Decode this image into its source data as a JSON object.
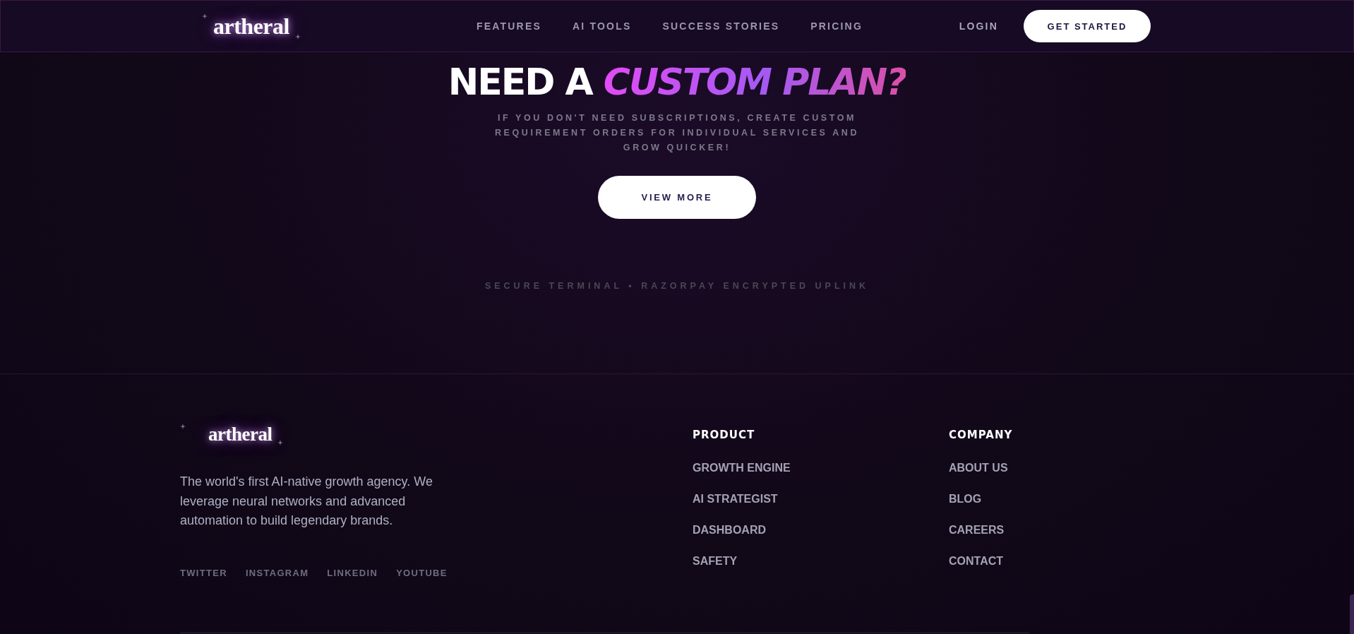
{
  "header": {
    "logo": "artheral",
    "nav": [
      {
        "label": "FEATURES"
      },
      {
        "label": "AI TOOLS"
      },
      {
        "label": "SUCCESS STORIES"
      },
      {
        "label": "PRICING"
      }
    ],
    "login": "LOGIN",
    "cta": "GET STARTED"
  },
  "hero": {
    "headline_plain": "NEED A",
    "headline_accent": "CUSTOM PLAN?",
    "subtitle": "IF YOU DON'T NEED SUBSCRIPTIONS, CREATE CUSTOM REQUIREMENT ORDERS FOR INDIVIDUAL SERVICES AND GROW QUICKER!",
    "button": "VIEW MORE",
    "security_note": "SECURE TERMINAL • RAZORPAY ENCRYPTED UPLINK"
  },
  "footer": {
    "logo": "artheral",
    "description": "The world's first AI-native growth agency. We leverage neural networks and advanced automation to build legendary brands.",
    "socials": [
      "TWITTER",
      "INSTAGRAM",
      "LINKEDIN",
      "YOUTUBE"
    ],
    "columns": [
      {
        "title": "PRODUCT",
        "links": [
          "GROWTH ENGINE",
          "AI STRATEGIST",
          "DASHBOARD",
          "SAFETY"
        ]
      },
      {
        "title": "COMPANY",
        "links": [
          "ABOUT US",
          "BLOG",
          "CAREERS",
          "CONTACT"
        ]
      }
    ]
  }
}
